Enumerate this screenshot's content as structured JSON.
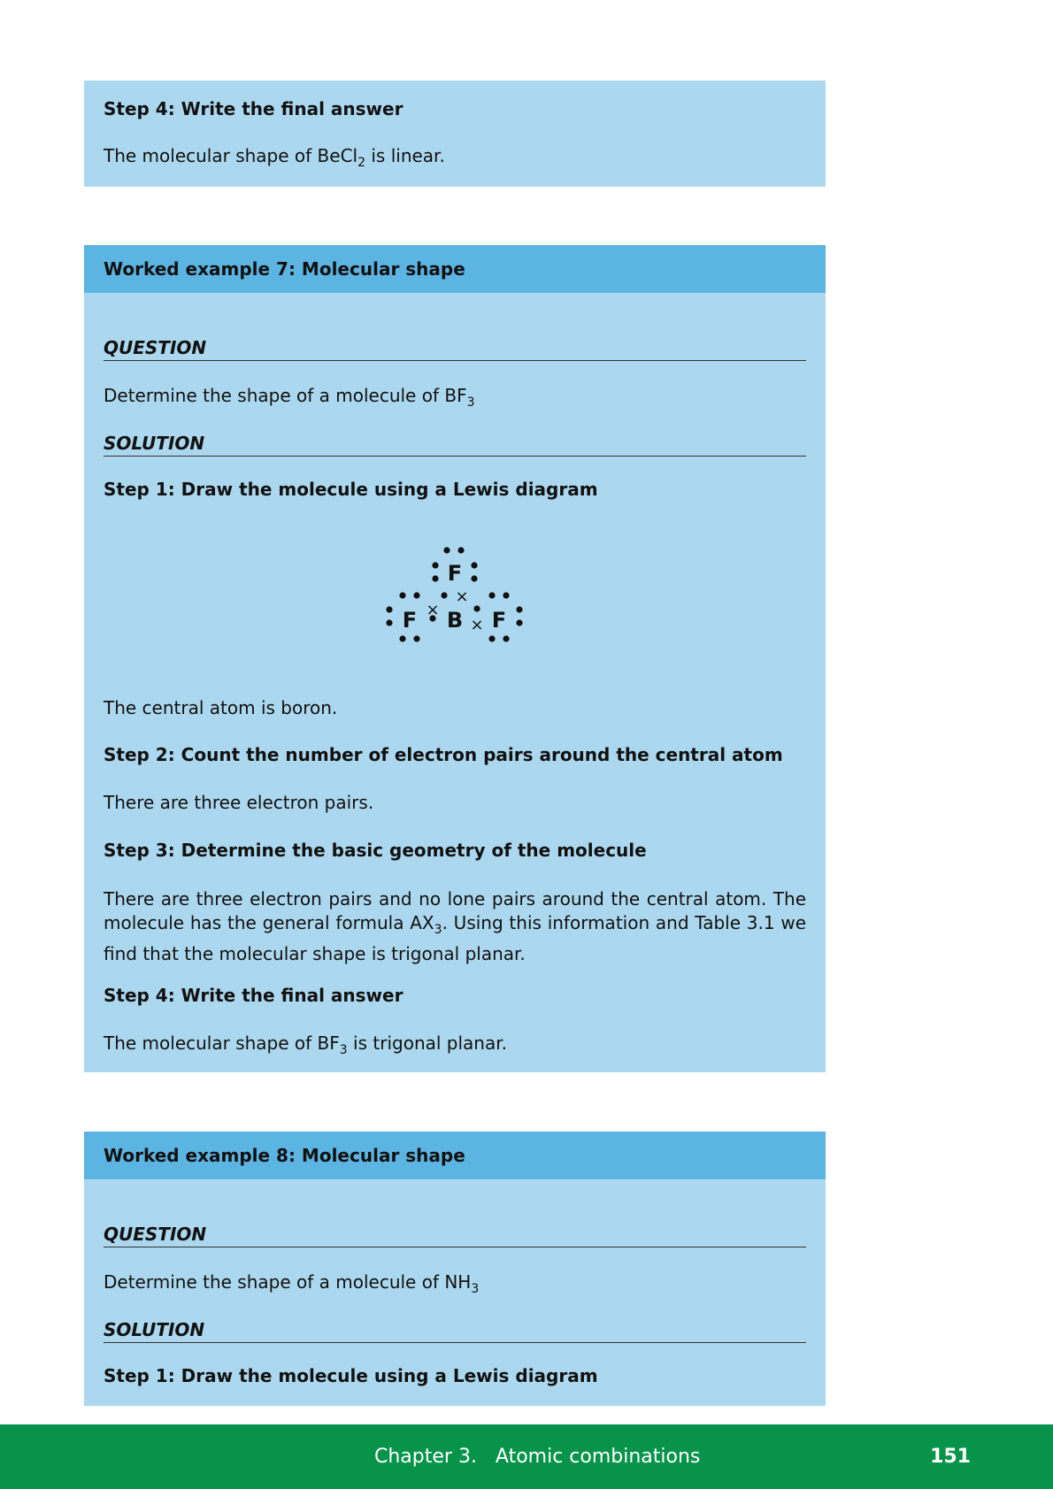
{
  "box1": {
    "step4_heading": "Step 4: Write the final answer",
    "answer_prefix": "The molecular shape of BeCl",
    "answer_sub": "2",
    "answer_suffix": " is linear."
  },
  "example7": {
    "title": "Worked example 7: Molecular shape",
    "question_heading": "QUESTION",
    "question_prefix": "Determine the shape of a molecule of BF",
    "question_sub": "3",
    "solution_heading": "SOLUTION",
    "step1_heading": "Step 1: Draw the molecule using a Lewis diagram",
    "lewis": {
      "top_atom": "F",
      "center_atom": "B",
      "left_atom": "F",
      "right_atom": "F",
      "cross": "×"
    },
    "central_atom_text": "The central atom is boron.",
    "step2_heading": "Step 2: Count the number of electron pairs around the central atom",
    "step2_text": "There are three electron pairs.",
    "step3_heading": "Step 3: Determine the basic geometry of the molecule",
    "step3_text_a": "There are three electron pairs and no lone pairs around the central atom. The molecule has the general formula AX",
    "step3_sub": "3",
    "step3_text_b": ". Using this information and Table 3.1 we find that the molecular shape is trigonal planar.",
    "step4_heading": "Step 4: Write the final answer",
    "answer_prefix": "The molecular shape of BF",
    "answer_sub": "3",
    "answer_suffix": " is trigonal planar."
  },
  "example8": {
    "title": "Worked example 8: Molecular shape",
    "question_heading": "QUESTION",
    "question_prefix": "Determine the shape of a molecule of NH",
    "question_sub": "3",
    "solution_heading": "SOLUTION",
    "step1_heading": "Step 1: Draw the molecule using a Lewis diagram"
  },
  "footer": {
    "chapter": "Chapter 3.   Atomic combinations",
    "page": "151"
  },
  "colors": {
    "box_bg": "#abd8ee",
    "box_header": "#5bb4e1",
    "footer_bg": "#07944a"
  }
}
